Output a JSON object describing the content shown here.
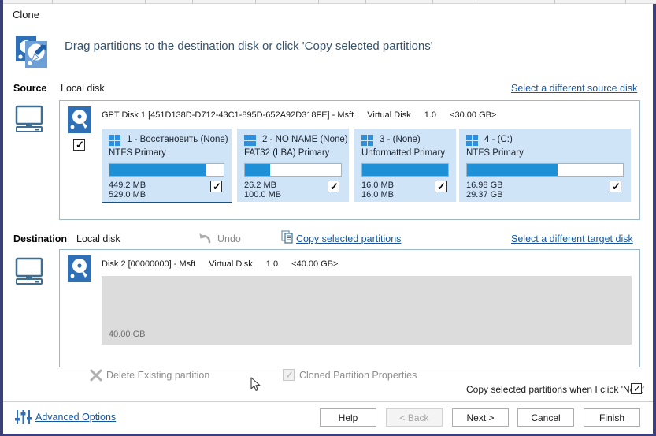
{
  "window": {
    "title": "Clone",
    "header_text": "Drag partitions to the destination disk or click 'Copy selected partitions'",
    "header_icon": "clone-disks-icon"
  },
  "source": {
    "label": "Source",
    "type_label": "Local disk",
    "select_link": "Select a different source disk",
    "monitor_icon": "computer-monitor-icon",
    "disk_icon": "hard-disk-icon",
    "disk_checkbox_checked": true,
    "disk_info": {
      "name": "GPT Disk 1 [451D138D-D712-43C1-895D-652A92D318FE] - Msft",
      "model": "Virtual Disk",
      "version": "1.0",
      "capacity": "<30.00 GB>"
    },
    "partitions": [
      {
        "icon": "windows-flag-icon",
        "title": "1 - Восстановить (None)",
        "filesystem": "NTFS Primary",
        "used": "449.2 MB",
        "total": "529.0 MB",
        "fill_percent": 85,
        "checked": true,
        "selected": true
      },
      {
        "icon": "windows-flag-icon",
        "title": "2 - NO NAME (None)",
        "filesystem": "FAT32 (LBA) Primary",
        "used": "26.2 MB",
        "total": "100.0 MB",
        "fill_percent": 26,
        "checked": true,
        "selected": false
      },
      {
        "icon": "windows-flag-icon",
        "title": "3 -  (None)",
        "filesystem": "Unformatted Primary",
        "used": "16.0 MB",
        "total": "16.0 MB",
        "fill_percent": 100,
        "checked": true,
        "selected": false
      },
      {
        "icon": "windows-flag-icon",
        "title": "4 -  (C:)",
        "filesystem": "NTFS Primary",
        "used": "16.98 GB",
        "total": "29.37 GB",
        "fill_percent": 58,
        "checked": true,
        "selected": false
      }
    ]
  },
  "destination": {
    "label": "Destination",
    "type_label": "Local disk",
    "undo_label": "Undo",
    "undo_icon": "undo-arrow-icon",
    "copy_label": "Copy selected partitions",
    "copy_icon": "copy-pages-icon",
    "select_link": "Select a different target disk",
    "monitor_icon": "computer-monitor-icon",
    "disk_icon": "hard-disk-icon",
    "disk_info": {
      "name": "Disk 2 [00000000] - Msft",
      "model": "Virtual Disk",
      "version": "1.0",
      "capacity": "<40.00 GB>"
    },
    "free_block_size": "40.00 GB"
  },
  "tools": {
    "delete_label": "Delete Existing partition",
    "delete_icon": "x-cross-icon",
    "properties_label": "Cloned Partition Properties",
    "properties_icon": "checkbox-icon",
    "copy_on_next_label": "Copy selected partitions when I click 'Next'",
    "copy_on_next_checked": true
  },
  "footer": {
    "advanced_label": "Advanced Options",
    "advanced_icon": "sliders-icon",
    "buttons": [
      {
        "label": "Help",
        "disabled": false
      },
      {
        "label": "< Back",
        "disabled": true
      },
      {
        "label": "Next >",
        "disabled": false
      },
      {
        "label": "Cancel",
        "disabled": false
      },
      {
        "label": "Finish",
        "disabled": false
      }
    ]
  },
  "colors": {
    "accent_blue": "#1e90d8",
    "panel_border": "#9fb8c8",
    "partition_bg": "#cfe4f7",
    "link": "#16569e",
    "window_frame": "#3b3f7a",
    "free_space": "#dcdcdc"
  }
}
